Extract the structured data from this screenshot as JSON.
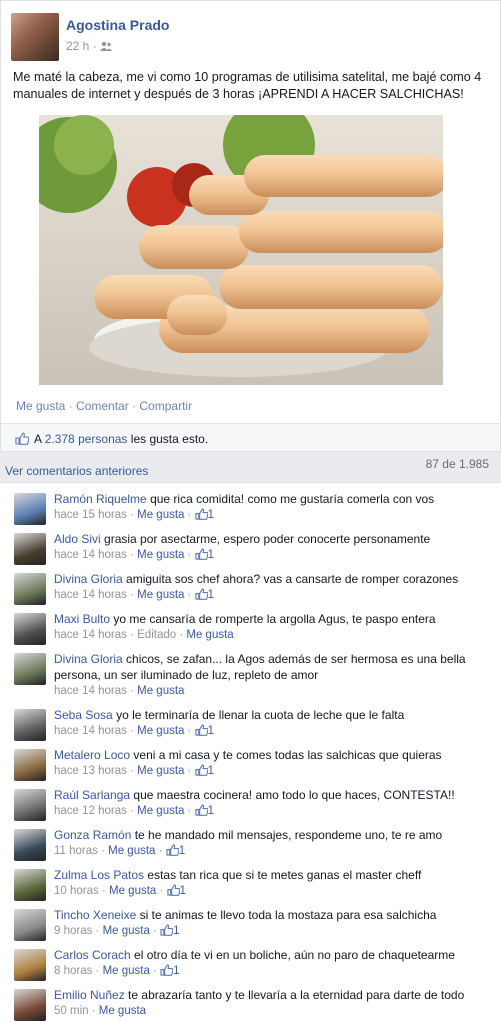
{
  "post": {
    "author": "Agostina Prado",
    "time": "22 h",
    "privacy_icon": "friends-icon",
    "text": "Me maté la cabeza, me vi como 10 programas de utilisima satelital, me bajé como 4 manuales de internet y después de 3 horas ¡APRENDI A HACER SALCHICHAS!",
    "actions": {
      "like": "Me gusta",
      "comment": "Comentar",
      "share": "Compartir",
      "sep": " · "
    },
    "likes": {
      "prefix": "A",
      "count": "2.378",
      "persons": "personas",
      "suffix": "les gusta esto."
    }
  },
  "comments_header": {
    "more": "Ver comentarios anteriores",
    "pager": "87 de 1.985"
  },
  "comments": [
    {
      "name": "Ramón Riquelme",
      "text": "que rica comidita! como me gustaría comerla con vos",
      "time": "hace 15 horas",
      "like": "Me gusta",
      "likes": "1",
      "color": "#5a7fb5"
    },
    {
      "name": "Aldo Sivi",
      "text": "grasia por asectarme, espero poder conocerte personamente",
      "time": "hace 14 horas",
      "like": "Me gusta",
      "likes": "1",
      "color": "#4a4030"
    },
    {
      "name": "Divina Gloria",
      "text": "amiguita sos chef ahora? vas a cansarte de romper corazones",
      "time": "hace 14 horas",
      "like": "Me gusta",
      "likes": "1",
      "color": "#6a7a5a"
    },
    {
      "name": "Maxi Bulto",
      "text": "yo me cansaría de romperte la argolla Agus, te paspo entera",
      "time": "hace 14 horas",
      "edited": "Editado",
      "like": "Me gusta",
      "likes": "",
      "color": "#505050"
    },
    {
      "name": "Divina Gloria",
      "text": "chicos, se zafan... la Agos además de ser hermosa es una bella persona, un ser iluminado de luz, repleto de amor",
      "time": "hace 14 horas",
      "like": "Me gusta",
      "likes": "",
      "color": "#6a7a5a"
    },
    {
      "name": "Seba Sosa",
      "text": "yo le terminaría de llenar la cuota de leche que le falta",
      "time": "hace 14 horas",
      "like": "Me gusta",
      "likes": "1",
      "color": "#606060"
    },
    {
      "name": "Metalero Loco",
      "text": "veni a mi casa y te comes todas las salchicas que quieras",
      "time": "hace 13 horas",
      "like": "Me gusta",
      "likes": "1",
      "color": "#8a6a40"
    },
    {
      "name": "Raúl Sarlanga",
      "text": "que maestra cocinera! amo todo lo que haces, CONTESTA!!",
      "time": "hace 12 horas",
      "like": "Me gusta",
      "likes": "1",
      "color": "#707070"
    },
    {
      "name": "Gonza Ramón",
      "text": "te he mandado mil mensajes, respondeme uno, te re amo",
      "time": "11 horas",
      "like": "Me gusta",
      "likes": "1",
      "color": "#3a4a5a"
    },
    {
      "name": "Zulma Los Patos",
      "text": "estas tan rica que si te metes ganas el master cheff",
      "time": "10 horas",
      "like": "Me gusta",
      "likes": "1",
      "color": "#5a6a3a"
    },
    {
      "name": "Tincho Xeneixe",
      "text": "si te animas te llevo toda la mostaza para esa salchicha",
      "time": "9 horas",
      "like": "Me gusta",
      "likes": "1",
      "color": "#8a8a8a"
    },
    {
      "name": "Carlos Corach",
      "text": "el otro día te vi en un boliche, aún no paro de chaquetearme",
      "time": "8 horas",
      "like": "Me gusta",
      "likes": "1",
      "color": "#b08040"
    },
    {
      "name": "Emilio Nuñez",
      "text": "te abrazaría tanto y te llevaría a la eternidad para darte de todo",
      "time": "50 min",
      "like": "Me gusta",
      "likes": "",
      "color": "#7a4a3a"
    }
  ]
}
